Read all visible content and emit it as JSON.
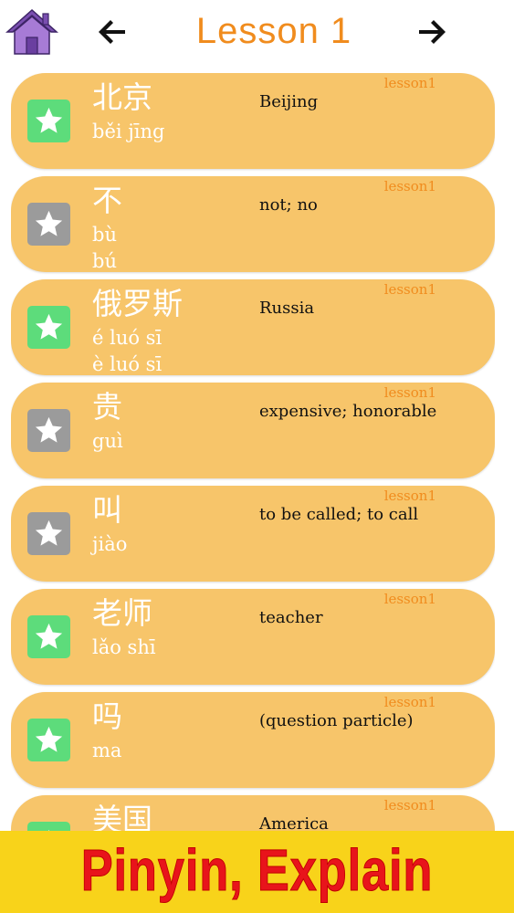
{
  "header": {
    "title": "Lesson 1",
    "home_icon": "house-icon",
    "prev_icon": "arrow-left-icon",
    "next_icon": "arrow-right-icon"
  },
  "colors": {
    "accent": "#f08c1e",
    "card": "#f7c56a",
    "star_on": "#5ddc7b",
    "star_off": "#9b9b9b",
    "banner": "#f8d31a",
    "banner_text": "#e8141b"
  },
  "cards": [
    {
      "hanzi": "北京",
      "pinyin": [
        "běi jīng"
      ],
      "meaning": "Beijing",
      "lesson": "lesson1",
      "starred": true
    },
    {
      "hanzi": "不",
      "pinyin": [
        "bù",
        "bú"
      ],
      "meaning": "not; no",
      "lesson": "lesson1",
      "starred": false
    },
    {
      "hanzi": "俄罗斯",
      "pinyin": [
        "é luó sī",
        "è luó sī"
      ],
      "meaning": "Russia",
      "lesson": "lesson1",
      "starred": true
    },
    {
      "hanzi": "贵",
      "pinyin": [
        "guì"
      ],
      "meaning": "expensive; honorable",
      "lesson": "lesson1",
      "starred": false
    },
    {
      "hanzi": "叫",
      "pinyin": [
        "jiào"
      ],
      "meaning": "to be called; to call",
      "lesson": "lesson1",
      "starred": false
    },
    {
      "hanzi": "老师",
      "pinyin": [
        "lǎo shī"
      ],
      "meaning": "teacher",
      "lesson": "lesson1",
      "starred": true
    },
    {
      "hanzi": "吗",
      "pinyin": [
        "ma"
      ],
      "meaning": "(question particle)",
      "lesson": "lesson1",
      "starred": true
    },
    {
      "hanzi": "美国",
      "pinyin": [
        ""
      ],
      "meaning": "America",
      "lesson": "lesson1",
      "starred": true
    }
  ],
  "banner": {
    "text": "Pinyin, Explain"
  }
}
